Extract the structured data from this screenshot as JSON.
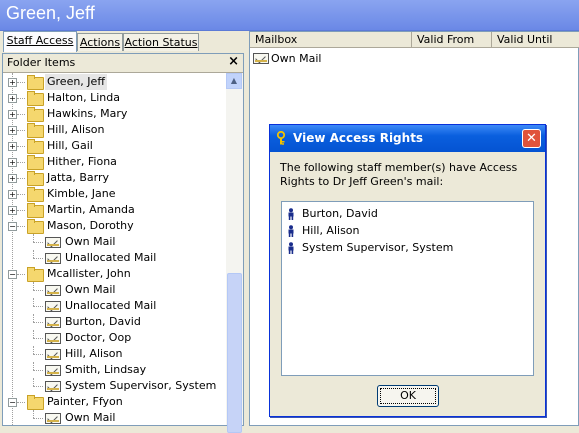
{
  "window_title": "Green, Jeff",
  "tabs": [
    {
      "label": "Staff Access"
    },
    {
      "label": "Actions"
    },
    {
      "label": "Action Status"
    }
  ],
  "left_panel": {
    "header": "Folder Items",
    "close_glyph": "×",
    "tree": [
      {
        "label": "Green, Jeff",
        "type": "folder",
        "expander": "+",
        "selected": true
      },
      {
        "label": "Halton, Linda",
        "type": "folder",
        "expander": "+"
      },
      {
        "label": "Hawkins, Mary",
        "type": "folder",
        "expander": "+"
      },
      {
        "label": "Hill, Alison",
        "type": "folder",
        "expander": "+"
      },
      {
        "label": "Hill, Gail",
        "type": "folder",
        "expander": "+"
      },
      {
        "label": "Hither, Fiona",
        "type": "folder",
        "expander": "+"
      },
      {
        "label": "Jatta, Barry",
        "type": "folder",
        "expander": "+"
      },
      {
        "label": "Kimble, Jane",
        "type": "folder",
        "expander": "+"
      },
      {
        "label": "Martin, Amanda",
        "type": "folder",
        "expander": "+"
      },
      {
        "label": "Mason, Dorothy",
        "type": "folder",
        "expander": "−"
      },
      {
        "label": "Own Mail",
        "type": "mail"
      },
      {
        "label": "Unallocated Mail",
        "type": "mail"
      },
      {
        "label": "Mcallister, John",
        "type": "folder",
        "expander": "−"
      },
      {
        "label": "Own Mail",
        "type": "mail"
      },
      {
        "label": "Unallocated Mail",
        "type": "mail"
      },
      {
        "label": "Burton, David",
        "type": "mail"
      },
      {
        "label": "Doctor, Oop",
        "type": "mail"
      },
      {
        "label": "Hill, Alison",
        "type": "mail"
      },
      {
        "label": "Smith, Lindsay",
        "type": "mail"
      },
      {
        "label": "System Supervisor, System",
        "type": "mail"
      },
      {
        "label": "Painter, Ffyon",
        "type": "folder",
        "expander": "−"
      },
      {
        "label": "Own Mail",
        "type": "mail"
      }
    ]
  },
  "right_panel": {
    "columns": [
      "Mailbox",
      "Valid From",
      "Valid Until"
    ],
    "rows": [
      {
        "mailbox": "Own Mail"
      }
    ]
  },
  "dialog": {
    "title": "View Access Rights",
    "close_glyph": "✕",
    "message": "The following staff member(s) have Access Rights to Dr Jeff Green's mail:",
    "people": [
      "Burton, David",
      "Hill, Alison",
      "System Supervisor, System"
    ],
    "ok_label": "OK"
  },
  "colors": {
    "title_bar": "#7a96ec",
    "dialog_title": "#0a5fde",
    "dialog_close": "#e0533b",
    "folder": "#f5d76e"
  }
}
